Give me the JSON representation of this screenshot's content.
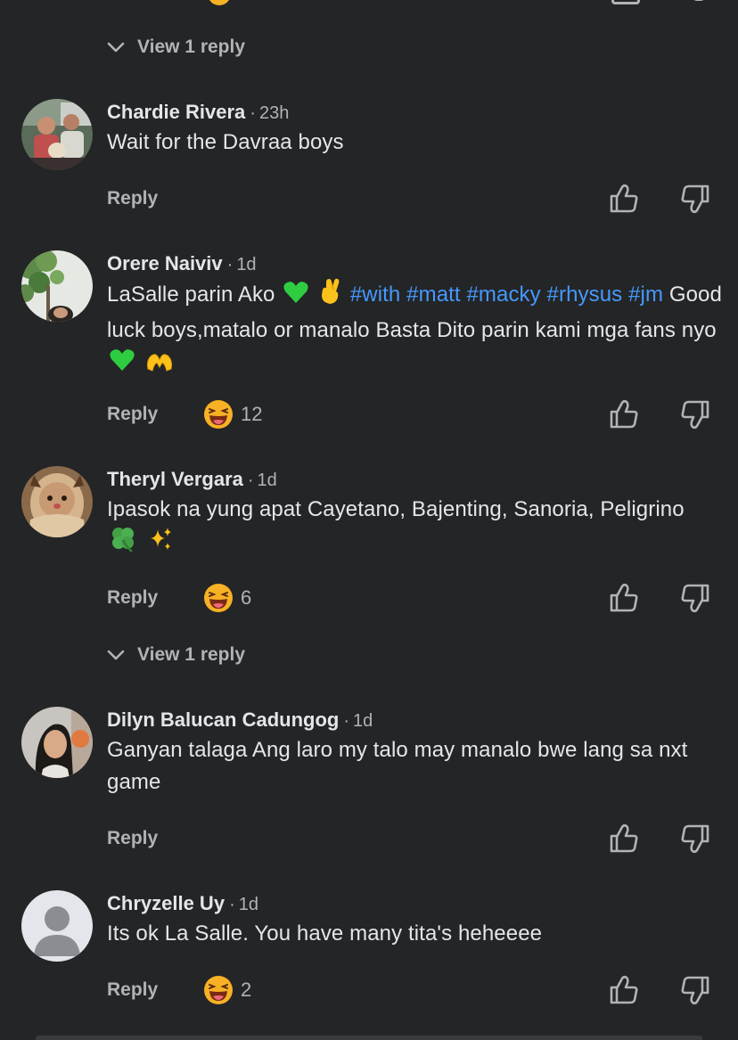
{
  "view_reply_top": "View 1 reply",
  "view_reply_mid": "View 1 reply",
  "reply_label": "Reply",
  "comments": [
    {
      "author": "Chardie Rivera",
      "time": "23h",
      "text": "Wait for the Davraa boys"
    },
    {
      "author": "Orere Naiviv",
      "time": "1d",
      "text_part1": "LaSalle parin Ako",
      "hashtags": [
        "#with",
        "#matt",
        "#macky",
        "#rhysus",
        "#jm"
      ],
      "text_part2": "Good luck boys,matalo or manalo Basta Dito parin kami mga fans nyo",
      "reaction_count": "12"
    },
    {
      "author": "Theryl Vergara",
      "time": "1d",
      "text": "Ipasok na yung apat Cayetano, Bajenting, Sanoria, Peligrino",
      "reaction_count": "6"
    },
    {
      "author": "Dilyn Balucan Cadungog",
      "time": "1d",
      "text": "Ganyan talaga Ang laro my talo may manalo bwe lang sa nxt game"
    },
    {
      "author": "Chryzelle Uy",
      "time": "1d",
      "text": "Its ok La Salle. You have many tita's heheeee",
      "reaction_count": "2"
    }
  ],
  "colors": {
    "background": "#242526",
    "primary_text": "#e4e6eb",
    "secondary_text": "#b0b3b8",
    "hashtag": "#4599ff",
    "heart_green": "#2ecc40"
  },
  "icons": [
    "chevron-down-icon",
    "thumbs-up-icon",
    "thumbs-down-icon",
    "laughing-emoji-icon",
    "green-heart-emoji",
    "crossed-fingers-emoji",
    "heart-hands-emoji",
    "four-leaf-clover-emoji",
    "sparkles-emoji"
  ]
}
